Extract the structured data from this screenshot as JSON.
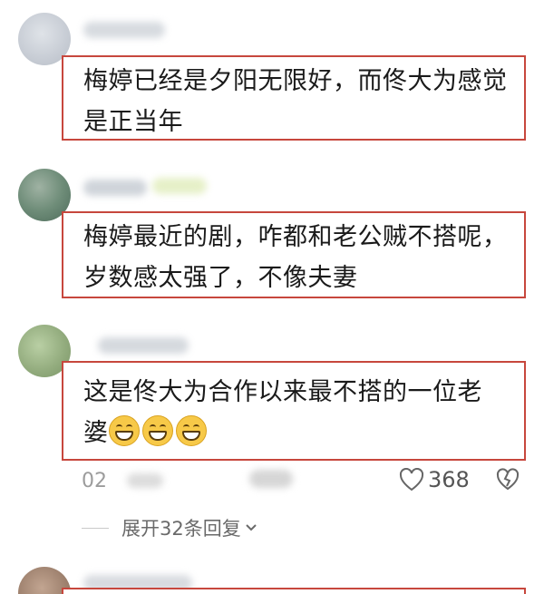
{
  "comments": [
    {
      "text_lines": [
        "梅婷已经是夕阳无限好，而佟大为感觉",
        "是正当年"
      ]
    },
    {
      "text_lines": [
        "梅婷最近的剧，咋都和老公贼不搭呢，",
        "岁数感太强了，不像夫妻"
      ]
    },
    {
      "text_lines": [
        "这是佟大为合作以来最不搭的一位老",
        "婆"
      ],
      "emoji": [
        "grin-emoji",
        "grin-emoji",
        "grin-emoji"
      ],
      "time_fragment": "02",
      "likes": "368",
      "expand_label": "展开32条回复"
    }
  ],
  "icons": {
    "like": "heart-outline-icon",
    "dislike": "broken-heart-icon",
    "expand": "chevron-down-icon"
  },
  "colors": {
    "highlight_border": "#c7473d",
    "emoji_yellow": "#f7c948",
    "meta_gray": "#9c9c9c"
  }
}
